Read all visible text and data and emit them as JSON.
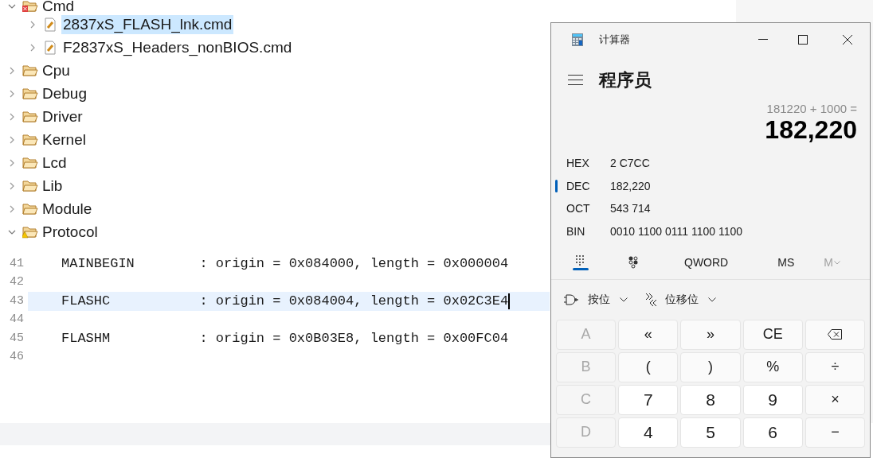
{
  "project_tree": [
    {
      "label": "Cmd",
      "kind": "folder",
      "error": true,
      "expanded": true,
      "selected": false,
      "children": [
        {
          "label": "2837xS_FLASH_lnk.cmd",
          "kind": "file",
          "expanded": false,
          "selected": true
        },
        {
          "label": "F2837xS_Headers_nonBIOS.cmd",
          "kind": "file",
          "expanded": false,
          "selected": false
        }
      ]
    },
    {
      "label": "Cpu",
      "kind": "folder",
      "expanded": false,
      "selected": false
    },
    {
      "label": "Debug",
      "kind": "folder",
      "expanded": false,
      "selected": false
    },
    {
      "label": "Driver",
      "kind": "folder",
      "expanded": false,
      "selected": false
    },
    {
      "label": "Kernel",
      "kind": "folder",
      "expanded": false,
      "selected": false
    },
    {
      "label": "Lcd",
      "kind": "folder",
      "expanded": false,
      "selected": false
    },
    {
      "label": "Lib",
      "kind": "folder",
      "expanded": false,
      "selected": false
    },
    {
      "label": "Module",
      "kind": "folder",
      "expanded": false,
      "selected": false
    },
    {
      "label": "Protocol",
      "kind": "folder",
      "warning": true,
      "expanded": true,
      "selected": false
    }
  ],
  "editor": {
    "lines": [
      {
        "number": "41",
        "text": "MAINBEGIN        : origin = 0x084000, length = 0x000004",
        "selected": false
      },
      {
        "number": "42",
        "selected": false
      },
      {
        "number": "43",
        "text": "FLASHC           : origin = 0x084004, length = 0x02C3E4",
        "selected": true
      },
      {
        "number": "44",
        "selected": false
      },
      {
        "number": "45",
        "text": "FLASHM           : origin = 0x0B03E8, length = 0x00FC04",
        "selected": false
      },
      {
        "number": "46",
        "selected": false
      }
    ]
  },
  "calculator": {
    "title": "计算器",
    "mode": "程序员",
    "expression": "181220 + 1000 =",
    "result": "182,220",
    "radix": [
      {
        "label": "HEX",
        "value": "2 C7CC",
        "selected": false
      },
      {
        "label": "DEC",
        "value": "182,220",
        "selected": true
      },
      {
        "label": "OCT",
        "value": "543 714",
        "selected": false
      },
      {
        "label": "BIN",
        "value": "0010 1100 0111 1100 1100",
        "selected": false
      }
    ],
    "word_size": "QWORD",
    "memory_store": "MS",
    "memory_recall": "M",
    "bitwise_menu": "按位",
    "shift_menu": "位移位",
    "keys": [
      {
        "label": "A",
        "kind": "disabled"
      },
      {
        "label": "«",
        "kind": "operator"
      },
      {
        "label": "»",
        "kind": "operator"
      },
      {
        "label": "CE",
        "kind": "operator"
      },
      {
        "kind": "backspace"
      },
      {
        "label": "B",
        "kind": "disabled"
      },
      {
        "label": "(",
        "kind": "operator"
      },
      {
        "label": ")",
        "kind": "operator"
      },
      {
        "label": "%",
        "kind": "operator"
      },
      {
        "label": "÷",
        "kind": "operator"
      },
      {
        "label": "C",
        "kind": "disabled"
      },
      {
        "label": "7",
        "kind": "digit"
      },
      {
        "label": "8",
        "kind": "digit"
      },
      {
        "label": "9",
        "kind": "digit"
      },
      {
        "label": "×",
        "kind": "operator"
      },
      {
        "label": "D",
        "kind": "disabled"
      },
      {
        "label": "4",
        "kind": "digit"
      },
      {
        "label": "5",
        "kind": "digit"
      },
      {
        "label": "6",
        "kind": "digit"
      },
      {
        "label": "−",
        "kind": "operator"
      }
    ]
  }
}
